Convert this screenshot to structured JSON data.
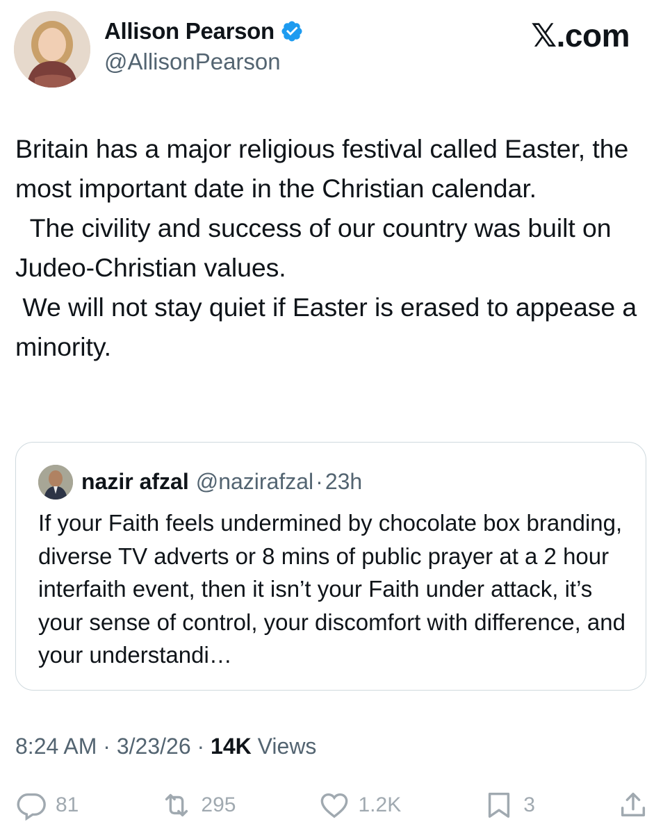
{
  "author": {
    "display_name": "Allison Pearson",
    "handle": "@AllisonPearson",
    "verified_badge_icon": "verified-badge-icon",
    "verified_color": "#1d9bf0"
  },
  "brand": "𝕏.com",
  "tweet": {
    "text": "Britain has a major religious festival called Easter, the most important date in the Christian calendar.\n  The civility and success of our country was built on Judeo-Christian values.\n We will not stay quiet if Easter is erased to appease a minority."
  },
  "quote": {
    "name": "nazir afzal",
    "handle": "@nazirafzal",
    "dot": "·",
    "time": "23h",
    "text": "If your Faith feels undermined by chocolate box branding, diverse TV adverts or 8 mins of public prayer at a 2 hour interfaith event, then it isn’t your Faith under attack, it’s your sense of control, your discomfort with difference, and your understandi…"
  },
  "meta": {
    "time": "8:24 AM",
    "sep": "·",
    "date": "3/23/26",
    "views_count": "14K",
    "views_label": "Views"
  },
  "actions": {
    "replies": "81",
    "reposts": "295",
    "likes": "1.2K",
    "bookmarks": "3"
  },
  "colors": {
    "text_primary": "#0f1419",
    "text_secondary": "#536471",
    "border": "#cfd9de"
  }
}
